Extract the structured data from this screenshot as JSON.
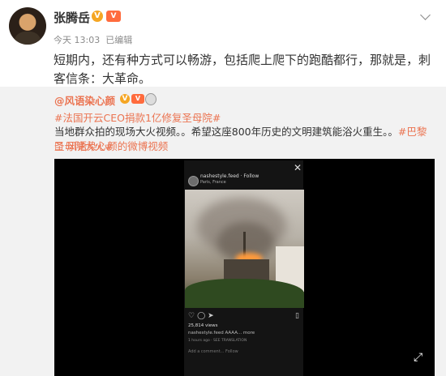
{
  "post": {
    "username": "张腾岳",
    "verified_badge": "V",
    "vip_badge": "V",
    "time": "今天 13:03",
    "edited": "已编辑",
    "text": "短期内，还有种方式可以畅游，包括爬上爬下的跑酷都行，那就是，刺客信条：大革命。"
  },
  "repost": {
    "author": "@风语染心颜",
    "topic": "#法国开云CEO捐款1亿修复圣母院#",
    "body_main": "当地群众拍的现场大火视频。。希望这座800年历史的文明建筑能浴火重生。。",
    "body_topic": "#巴黎圣母院大火#",
    "video_link": "风语染心颜的微博视频"
  },
  "video": {
    "ig_username": "nashestyle.feed · Follow",
    "ig_location": "Paris, France",
    "views": "25,814 views",
    "caption": "nashestyle.feed AAAA... more",
    "translation": "1 hours ago · SEE TRANSLATION",
    "comment_placeholder": "Add a comment...  Follow"
  },
  "icons": [
    "dropdown-chevron-icon",
    "heart-icon",
    "comment-icon",
    "share-icon",
    "bookmark-icon",
    "close-icon",
    "fullscreen-icon"
  ]
}
